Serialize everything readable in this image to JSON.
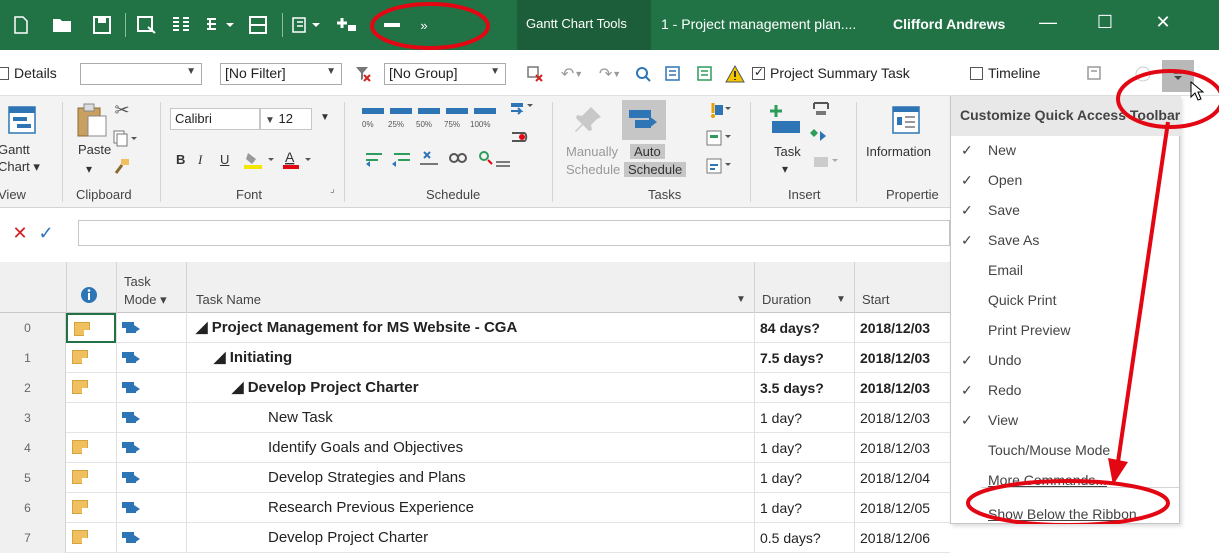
{
  "title_bar": {
    "contextual_tab": "Gantt Chart Tools",
    "document_title": "1 - Project management plan....",
    "user": "Clifford Andrews",
    "minimize": "—",
    "restore": "☐",
    "close": "✕"
  },
  "quick_row": {
    "details_label": "Details",
    "filter_value": "[No Filter]",
    "group_value": "[No Group]",
    "project_summary_label": "Project Summary Task",
    "timeline_label": "Timeline"
  },
  "ribbon": {
    "view": {
      "button": "Gantt Chart",
      "button_line1": "Gantt",
      "button_line2": "Chart ▾",
      "label": "View"
    },
    "clipboard": {
      "paste": "Paste",
      "label": "Clipboard"
    },
    "font": {
      "family": "Calibri",
      "size": "12",
      "bold": "B",
      "italic": "I",
      "underline": "U",
      "label": "Font"
    },
    "schedule": {
      "label": "Schedule",
      "pct": [
        "0%",
        "25%",
        "50%",
        "75%",
        "100%"
      ]
    },
    "tasks": {
      "manually_line1": "Manually",
      "manually_line2": "Schedule",
      "auto_line1": "Auto",
      "auto_line2": "Schedule",
      "label": "Tasks"
    },
    "insert": {
      "task": "Task",
      "label": "Insert"
    },
    "properties": {
      "information": "Information",
      "label": "Propertie"
    }
  },
  "grid": {
    "headers": {
      "task_mode_line1": "Task",
      "task_mode_line2": "Mode ▾",
      "task_name": "Task Name",
      "duration": "Duration",
      "start": "Start"
    },
    "rows": [
      {
        "id": "0",
        "name": "◢ Project Management for MS Website - CGA",
        "duration": "84 days?",
        "start": "2018/12/03",
        "bold": true,
        "indent": 0,
        "note": true
      },
      {
        "id": "1",
        "name": "◢ Initiating",
        "duration": "7.5 days?",
        "start": "2018/12/03",
        "bold": true,
        "indent": 1,
        "note": true
      },
      {
        "id": "2",
        "name": "◢ Develop Project Charter",
        "duration": "3.5 days?",
        "start": "2018/12/03",
        "bold": true,
        "indent": 2,
        "note": true
      },
      {
        "id": "3",
        "name": "New Task",
        "duration": "1 day?",
        "start": "2018/12/03",
        "bold": false,
        "indent": 3,
        "note": false
      },
      {
        "id": "4",
        "name": "Identify Goals and Objectives",
        "duration": "1 day?",
        "start": "2018/12/03",
        "bold": false,
        "indent": 3,
        "note": true
      },
      {
        "id": "5",
        "name": "Develop Strategies and Plans",
        "duration": "1 day?",
        "start": "2018/12/04",
        "bold": false,
        "indent": 3,
        "note": true
      },
      {
        "id": "6",
        "name": "Research Previous Experience",
        "duration": "1 day?",
        "start": "2018/12/05",
        "bold": false,
        "indent": 3,
        "note": true
      },
      {
        "id": "7",
        "name": "Develop Project Charter",
        "duration": "0.5 days?",
        "start": "2018/12/06",
        "bold": false,
        "indent": 3,
        "note": true
      }
    ]
  },
  "menu": {
    "title": "Customize Quick Access Toolbar",
    "items": [
      {
        "label": "New",
        "checked": true
      },
      {
        "label": "Open",
        "checked": true
      },
      {
        "label": "Save",
        "checked": true
      },
      {
        "label": "Save As",
        "checked": true
      },
      {
        "label": "Email",
        "checked": false
      },
      {
        "label": "Quick Print",
        "checked": false
      },
      {
        "label": "Print Preview",
        "checked": false
      },
      {
        "label": "Undo",
        "checked": true
      },
      {
        "label": "Redo",
        "checked": true
      },
      {
        "label": "View",
        "checked": true
      },
      {
        "label": "Touch/Mouse Mode",
        "checked": false
      },
      {
        "label": "More Commands...",
        "checked": false
      },
      {
        "label": "Show Below the Ribbon",
        "checked": false
      }
    ]
  },
  "colors": {
    "title_bar": "#217346",
    "annotation": "#e30613",
    "task_mode_icon": "#2e75b6",
    "note_icon": "#f0c060"
  }
}
